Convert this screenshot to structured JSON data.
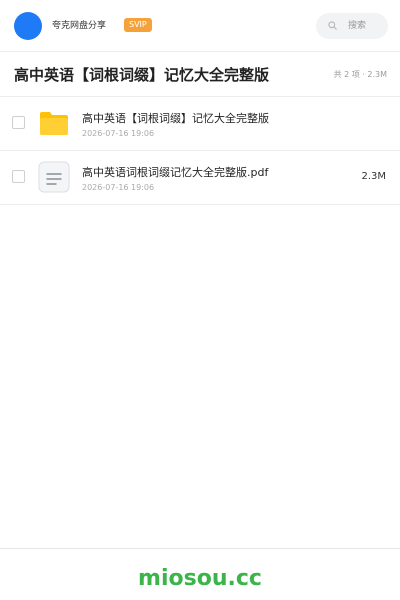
{
  "header": {
    "brand_name": "夸克网盘分享",
    "badge": "SVIP",
    "search_placeholder": "搜索"
  },
  "share": {
    "title": "高中英语【词根词缀】记忆大全完整版",
    "summary": "共 2 项 · 2.3M"
  },
  "files": [
    {
      "name": "高中英语【词根词缀】记忆大全完整版",
      "date": "2026-07-16 19:06",
      "size": "",
      "icon": "folder-icon",
      "checked": false
    },
    {
      "name": "高中英语词根词缀记忆大全完整版.pdf",
      "date": "2026-07-16 19:06",
      "size": "2.3M",
      "icon": "document-icon",
      "checked": false
    }
  ],
  "footer": {
    "watermark": "miosou.cc"
  },
  "colors": {
    "avatar": "#1f7af5",
    "badge": "#f6a23a",
    "folder": "#ffc107",
    "watermark": "#3bb44a"
  }
}
